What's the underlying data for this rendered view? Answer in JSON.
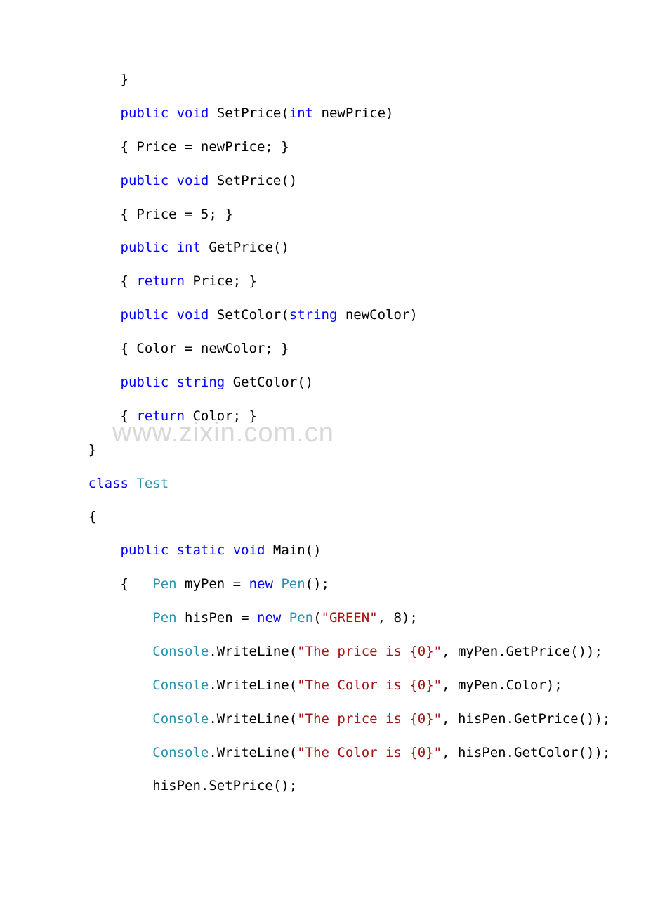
{
  "watermark": "www.zixin.com.cn",
  "lines": [
    {
      "indent": "        ",
      "tokens": [
        {
          "t": "}",
          "c": "plain"
        }
      ]
    },
    {
      "indent": "        ",
      "tokens": [
        {
          "t": "public",
          "c": "kw"
        },
        {
          "t": " ",
          "c": "plain"
        },
        {
          "t": "void",
          "c": "kw"
        },
        {
          "t": " SetPrice(",
          "c": "plain"
        },
        {
          "t": "int",
          "c": "kw"
        },
        {
          "t": " newPrice)",
          "c": "plain"
        }
      ]
    },
    {
      "indent": "        ",
      "tokens": [
        {
          "t": "{ Price = newPrice; }",
          "c": "plain"
        }
      ]
    },
    {
      "indent": "        ",
      "tokens": [
        {
          "t": "public",
          "c": "kw"
        },
        {
          "t": " ",
          "c": "plain"
        },
        {
          "t": "void",
          "c": "kw"
        },
        {
          "t": " SetPrice()",
          "c": "plain"
        }
      ]
    },
    {
      "indent": "        ",
      "tokens": [
        {
          "t": "{ Price = 5; }",
          "c": "plain"
        }
      ]
    },
    {
      "indent": "        ",
      "tokens": [
        {
          "t": "public",
          "c": "kw"
        },
        {
          "t": " ",
          "c": "plain"
        },
        {
          "t": "int",
          "c": "kw"
        },
        {
          "t": " GetPrice()",
          "c": "plain"
        }
      ]
    },
    {
      "indent": "        ",
      "tokens": [
        {
          "t": "{ ",
          "c": "plain"
        },
        {
          "t": "return",
          "c": "kw"
        },
        {
          "t": " Price; }",
          "c": "plain"
        }
      ]
    },
    {
      "indent": "        ",
      "tokens": [
        {
          "t": "public",
          "c": "kw"
        },
        {
          "t": " ",
          "c": "plain"
        },
        {
          "t": "void",
          "c": "kw"
        },
        {
          "t": " SetColor(",
          "c": "plain"
        },
        {
          "t": "string",
          "c": "kw"
        },
        {
          "t": " newColor)",
          "c": "plain"
        }
      ]
    },
    {
      "indent": "        ",
      "tokens": [
        {
          "t": "{ Color = newColor; }",
          "c": "plain"
        }
      ]
    },
    {
      "indent": "        ",
      "tokens": [
        {
          "t": "public",
          "c": "kw"
        },
        {
          "t": " ",
          "c": "plain"
        },
        {
          "t": "string",
          "c": "kw"
        },
        {
          "t": " GetColor()",
          "c": "plain"
        }
      ]
    },
    {
      "indent": "        ",
      "tokens": [
        {
          "t": "{ ",
          "c": "plain"
        },
        {
          "t": "return",
          "c": "kw"
        },
        {
          "t": " Color; }",
          "c": "plain"
        }
      ]
    },
    {
      "indent": "    ",
      "tokens": [
        {
          "t": "}",
          "c": "plain"
        }
      ]
    },
    {
      "indent": "    ",
      "tokens": [
        {
          "t": "class",
          "c": "kw"
        },
        {
          "t": " ",
          "c": "plain"
        },
        {
          "t": "Test",
          "c": "type"
        }
      ]
    },
    {
      "indent": "    ",
      "tokens": [
        {
          "t": "{",
          "c": "plain"
        }
      ]
    },
    {
      "indent": "        ",
      "tokens": [
        {
          "t": "public",
          "c": "kw"
        },
        {
          "t": " ",
          "c": "plain"
        },
        {
          "t": "static",
          "c": "kw"
        },
        {
          "t": " ",
          "c": "plain"
        },
        {
          "t": "void",
          "c": "kw"
        },
        {
          "t": " Main()",
          "c": "plain"
        }
      ]
    },
    {
      "indent": "        ",
      "tokens": [
        {
          "t": "{   ",
          "c": "plain"
        },
        {
          "t": "Pen",
          "c": "type"
        },
        {
          "t": " myPen = ",
          "c": "plain"
        },
        {
          "t": "new",
          "c": "kw"
        },
        {
          "t": " ",
          "c": "plain"
        },
        {
          "t": "Pen",
          "c": "type"
        },
        {
          "t": "();",
          "c": "plain"
        }
      ]
    },
    {
      "indent": "            ",
      "tokens": [
        {
          "t": "Pen",
          "c": "type"
        },
        {
          "t": " hisPen = ",
          "c": "plain"
        },
        {
          "t": "new",
          "c": "kw"
        },
        {
          "t": " ",
          "c": "plain"
        },
        {
          "t": "Pen",
          "c": "type"
        },
        {
          "t": "(",
          "c": "plain"
        },
        {
          "t": "\"GREEN\"",
          "c": "str"
        },
        {
          "t": ", 8);",
          "c": "plain"
        }
      ]
    },
    {
      "indent": "            ",
      "tokens": [
        {
          "t": "Console",
          "c": "type"
        },
        {
          "t": ".WriteLine(",
          "c": "plain"
        },
        {
          "t": "\"The price is {0}\"",
          "c": "str"
        },
        {
          "t": ", myPen.GetPrice());",
          "c": "plain"
        }
      ]
    },
    {
      "indent": "            ",
      "tokens": [
        {
          "t": "Console",
          "c": "type"
        },
        {
          "t": ".WriteLine(",
          "c": "plain"
        },
        {
          "t": "\"The Color is {0}\"",
          "c": "str"
        },
        {
          "t": ", myPen.Color);",
          "c": "plain"
        }
      ]
    },
    {
      "indent": "            ",
      "tokens": [
        {
          "t": "Console",
          "c": "type"
        },
        {
          "t": ".WriteLine(",
          "c": "plain"
        },
        {
          "t": "\"The price is {0}\"",
          "c": "str"
        },
        {
          "t": ", hisPen.GetPrice());",
          "c": "plain"
        }
      ]
    },
    {
      "indent": "            ",
      "tokens": [
        {
          "t": "Console",
          "c": "type"
        },
        {
          "t": ".WriteLine(",
          "c": "plain"
        },
        {
          "t": "\"The Color is {0}\"",
          "c": "str"
        },
        {
          "t": ", hisPen.GetColor());",
          "c": "plain"
        }
      ]
    },
    {
      "indent": "            ",
      "tokens": [
        {
          "t": "hisPen.SetPrice();",
          "c": "plain"
        }
      ]
    }
  ]
}
